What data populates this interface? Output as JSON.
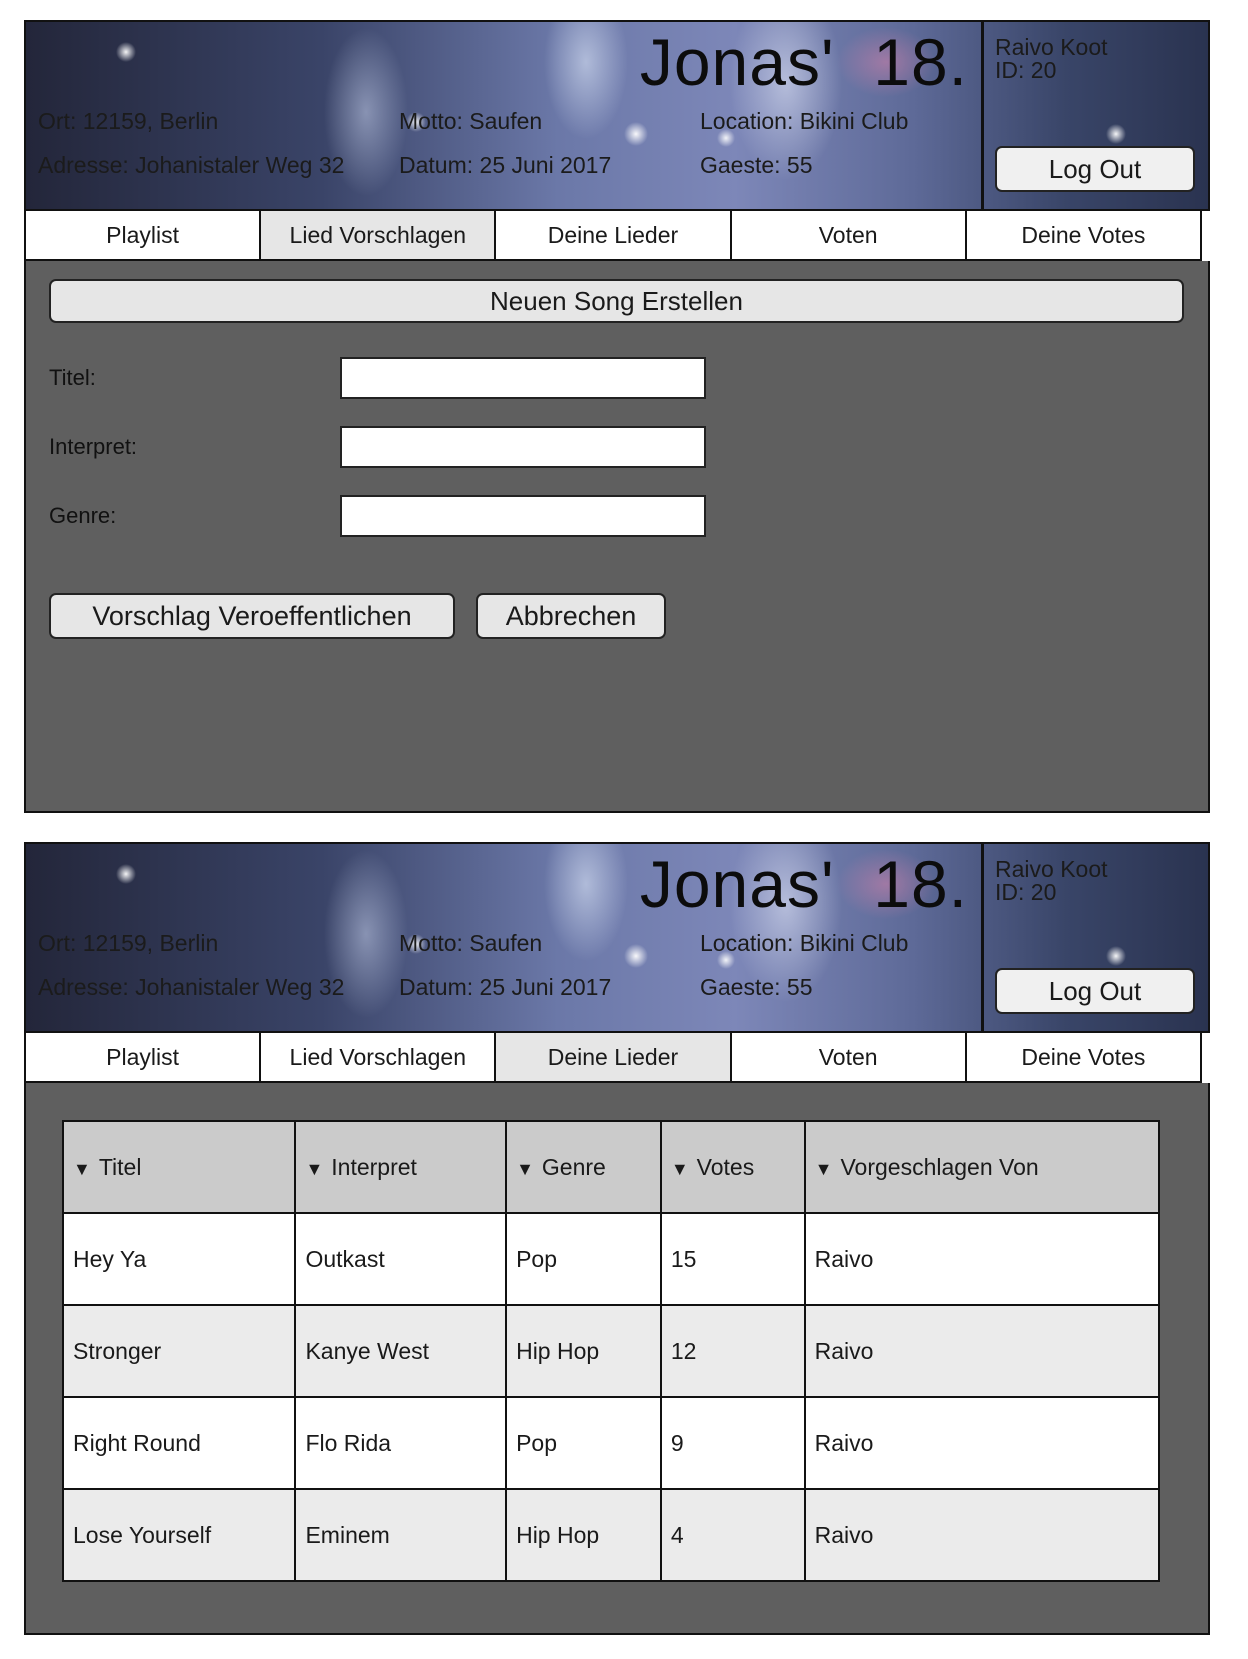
{
  "event": {
    "title": "Jonas'  18.",
    "ort": "Ort: 12159, Berlin",
    "adresse": "Adresse: Johanistaler Weg 32",
    "motto": "Motto: Saufen",
    "datum": "Datum: 25 Juni 2017",
    "location": "Location: Bikini Club",
    "gaeste": "Gaeste: 55"
  },
  "user": {
    "name": "Raivo Koot",
    "id": "ID: 20",
    "logout_label": "Log Out"
  },
  "tabs": [
    {
      "label": "Playlist"
    },
    {
      "label": "Lied Vorschlagen"
    },
    {
      "label": "Deine Lieder"
    },
    {
      "label": "Voten"
    },
    {
      "label": "Deine Votes"
    }
  ],
  "screen1": {
    "active_tab": "Lied Vorschlagen",
    "create_button": "Neuen Song Erstellen",
    "fields": {
      "titel_label": "Titel:",
      "titel_value": "",
      "interpret_label": "Interpret:",
      "interpret_value": "",
      "genre_label": "Genre:",
      "genre_value": ""
    },
    "publish_button": "Vorschlag Veroeffentlichen",
    "cancel_button": "Abbrechen"
  },
  "screen2": {
    "active_tab": "Deine Lieder",
    "sort_icon": "▼",
    "columns": [
      "Titel",
      "Interpret",
      "Genre",
      "Votes",
      "Vorgeschlagen Von"
    ],
    "rows": [
      [
        "Hey Ya",
        "Outkast",
        "Pop",
        "15",
        "Raivo"
      ],
      [
        "Stronger",
        "Kanye West",
        "Hip Hop",
        "12",
        "Raivo"
      ],
      [
        "Right Round",
        "Flo Rida",
        "Pop",
        "9",
        "Raivo"
      ],
      [
        "Lose Yourself",
        "Eminem",
        "Hip Hop",
        "4",
        "Raivo"
      ]
    ]
  }
}
